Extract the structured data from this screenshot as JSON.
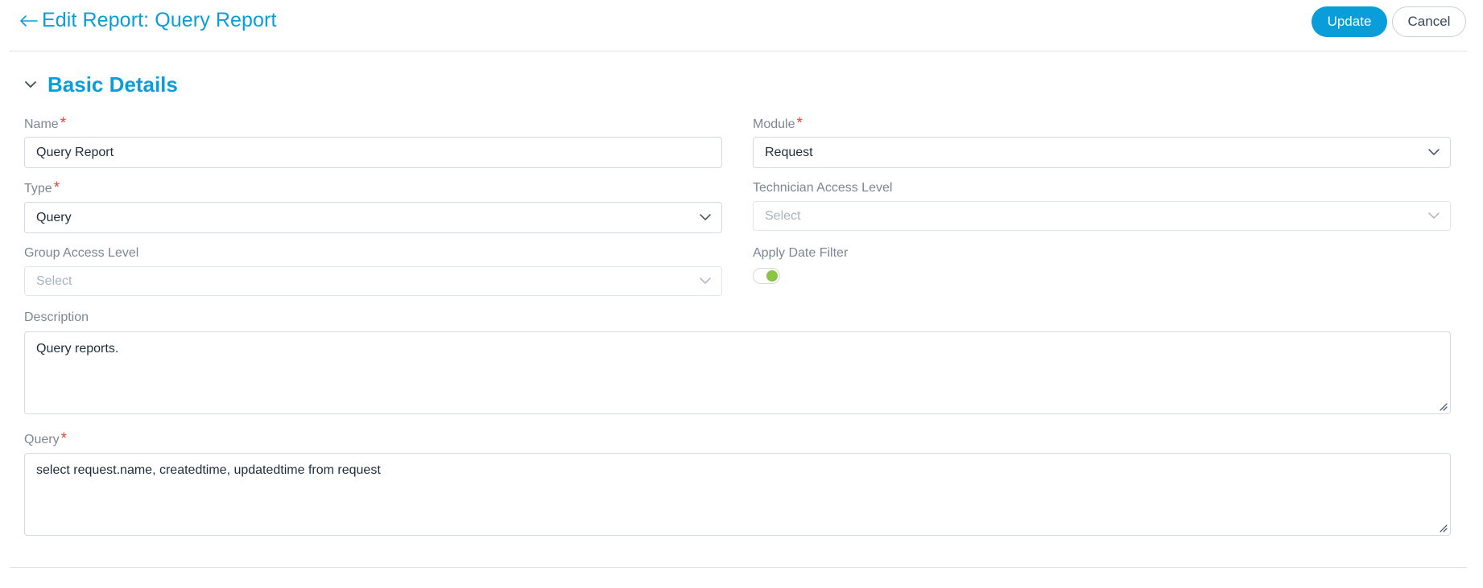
{
  "header": {
    "title": "Edit Report: Query Report",
    "update_label": "Update",
    "cancel_label": "Cancel"
  },
  "section": {
    "title": "Basic Details"
  },
  "form": {
    "name": {
      "label": "Name",
      "required": "*",
      "value": "Query Report"
    },
    "module": {
      "label": "Module",
      "required": "*",
      "value": "Request"
    },
    "type": {
      "label": "Type",
      "required": "*",
      "value": "Query"
    },
    "technician_access": {
      "label": "Technician Access Level",
      "placeholder": "Select"
    },
    "group_access": {
      "label": "Group Access Level",
      "placeholder": "Select"
    },
    "apply_date_filter": {
      "label": "Apply Date Filter",
      "enabled": true
    },
    "description": {
      "label": "Description",
      "value": "Query reports."
    },
    "query": {
      "label": "Query",
      "required": "*",
      "value": "select request.name, createdtime, updatedtime from request"
    }
  },
  "colors": {
    "accent": "#099dd9",
    "required": "#f04134",
    "toggle_on": "#89c540"
  },
  "icons": {
    "back": "arrow-left-icon",
    "section_toggle": "chevron-down-icon",
    "select": "chevron-down-icon",
    "resize": "resize-handle-icon"
  }
}
